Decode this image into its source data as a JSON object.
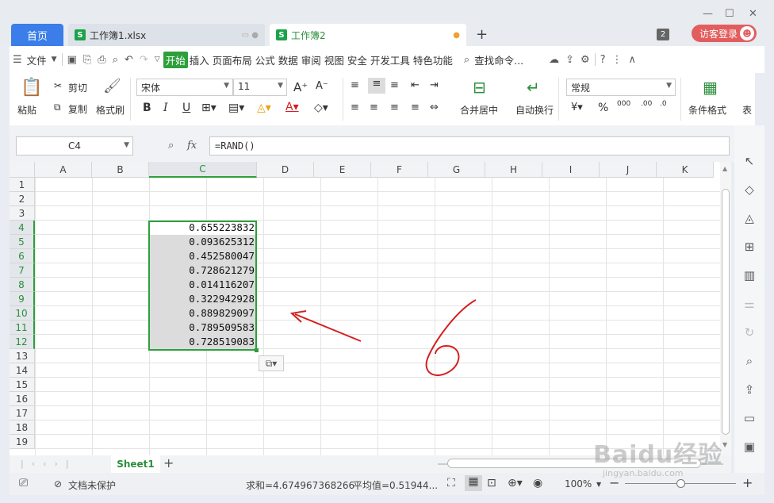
{
  "tabs": {
    "home": "首页",
    "doc1": "工作簿1.xlsx",
    "doc2": "工作簿2",
    "count": "2",
    "login": "访客登录"
  },
  "menu": {
    "file": "文件",
    "items": [
      "开始",
      "插入",
      "页面布局",
      "公式",
      "数据",
      "审阅",
      "视图",
      "安全",
      "开发工具",
      "特色功能"
    ],
    "search": "查找命令..."
  },
  "ribbon": {
    "paste": "粘贴",
    "cut": "剪切",
    "copy": "复制",
    "format_painter": "格式刷",
    "font": "宋体",
    "size": "11",
    "number_format": "常规",
    "merge": "合并居中",
    "wrap": "自动换行",
    "cond_format": "条件格式",
    "table": "表",
    "bold": "B",
    "italic": "I",
    "underline": "U"
  },
  "formula": {
    "name_box": "C4",
    "fx": "fx",
    "content": "=RAND()"
  },
  "columns": [
    "A",
    "B",
    "C",
    "D",
    "E",
    "F",
    "G",
    "H",
    "I",
    "J",
    "K"
  ],
  "rows": [
    "1",
    "2",
    "3",
    "4",
    "5",
    "6",
    "7",
    "8",
    "9",
    "10",
    "11",
    "12",
    "13",
    "14",
    "15",
    "16",
    "17",
    "18",
    "19"
  ],
  "cells": [
    "0.655223832",
    "0.093625312",
    "0.452580047",
    "0.728621279",
    "0.014116207",
    "0.322942928",
    "0.889829097",
    "0.789509583",
    "0.728519083"
  ],
  "sheet": {
    "name": "Sheet1"
  },
  "status": {
    "protect": "文档未保护",
    "sum": "求和=4.674967368266",
    "avg": "平均值=0.51944...",
    "zoom": "100%"
  },
  "annotation": {
    "handwritten": "6",
    "color": "#d42020"
  },
  "watermark": {
    "brand": "Baidu经验",
    "url": "jingyan.baidu.com"
  }
}
